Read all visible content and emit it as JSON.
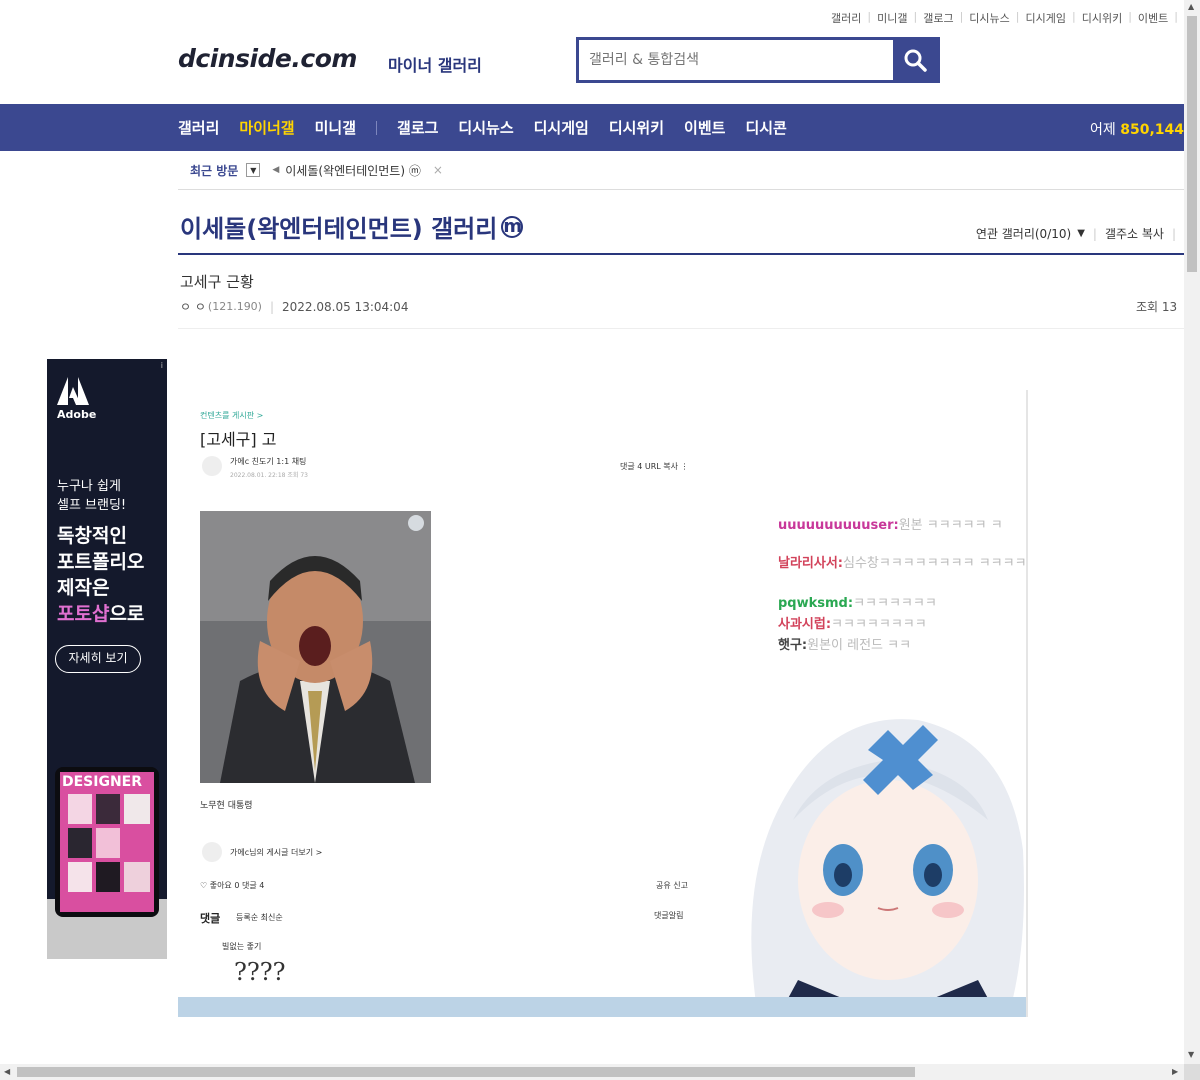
{
  "util_links": [
    "갤러리",
    "미니갤",
    "갤로그",
    "디시뉴스",
    "디시게임",
    "디시위키",
    "이벤트"
  ],
  "header": {
    "logo": "dcinside.com",
    "logo_sub": "마이너 갤러리",
    "search_placeholder": "갤러리 & 통합검색",
    "search_icon": "search-icon"
  },
  "nav": {
    "items": [
      "갤러리",
      "마이너갤",
      "미니갤",
      "갤로그",
      "디시뉴스",
      "디시게임",
      "디시위키",
      "이벤트",
      "디시콘"
    ],
    "yesterday_label": "어제",
    "yesterday_value": "850,144"
  },
  "recent": {
    "label": "최근 방문",
    "gallery": "이세돌(왁엔터테인먼트) ⓜ",
    "close": "×"
  },
  "gallery": {
    "title": "이세돌(왁엔터테인먼트) 갤러리",
    "minor_mark": "m",
    "related": "연관 갤러리(0/10)",
    "copy_address": "갤주소 복사"
  },
  "post": {
    "title": "고세구 근황",
    "author": "ㅇ ㅇ",
    "ip": "(121.190)",
    "date": "2022.08.05 13:04:04",
    "views_label": "조회 13"
  },
  "ad": {
    "brand": "Adobe",
    "line1": "누구나 쉽게",
    "line2": "셀프 브랜딩!",
    "head1": "독창적인",
    "head2": "포트폴리오",
    "head3": "제작은",
    "head4_pink": "포토샵",
    "head4_rest": "으로",
    "button": "자세히 보기",
    "tablet_text": "DESIGNER",
    "info_icon": "i",
    "accent": "#e070d0"
  },
  "embedded": {
    "breadcrumb": "컨텐츠를 게시판 >",
    "title": "[고세구] 고",
    "author_line": "가에c  친도기  1:1 채팅",
    "date_line": "2022.08.01. 22:18   조회 73",
    "comments_top": "댓글 4   URL 복사   ⋮",
    "caption": "노무현 대통령",
    "more_posts": "가에c님의 게시글 더보기 >",
    "likes": "♡ 좋아요 0    댓글 4",
    "share": "공유   신고",
    "reply_header": "댓글",
    "reply_options": "등록순   최신순",
    "reply_toggle": "댓글알림",
    "reply_nick": "빌없는 좋기",
    "reply_content": "????",
    "chat": [
      {
        "name": "uuuuuuuuuuser:",
        "message": "원본 ㅋㅋㅋㅋㅋ ㅋ",
        "color": "#c8389a"
      },
      {
        "name": "날라리사서:",
        "message": "심수창ㅋㅋㅋㅋㅋㅋㅋㅋ ㅋㅋㅋㅋㅋㅋㅋ",
        "color": "#d2425a"
      },
      {
        "name": "pqwksmd:",
        "message": "ㅋㅋㅋㅋㅋㅋㅋ",
        "color": "#2aa852"
      },
      {
        "name": "사과시럽:",
        "message": "ㅋㅋㅋㅋㅋㅋㅋㅋ",
        "color": "#d2425a"
      },
      {
        "name": "햇구:",
        "message": "원본이 레전드 ㅋㅋ",
        "color": "#444444"
      }
    ]
  }
}
